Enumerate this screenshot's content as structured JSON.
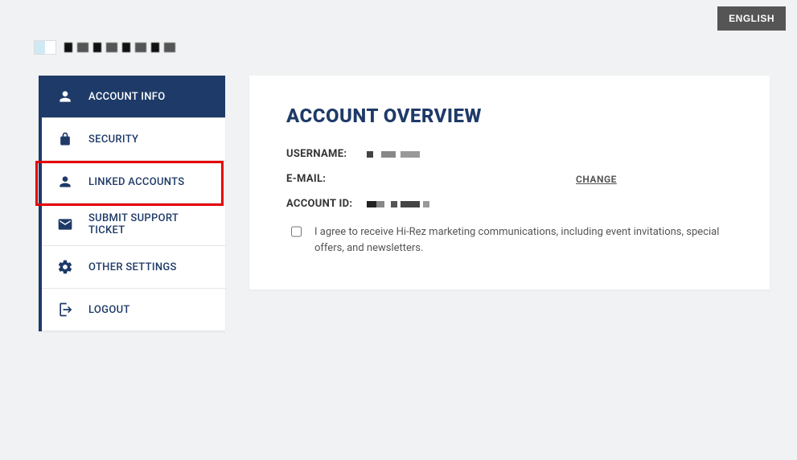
{
  "lang_button": "ENGLISH",
  "sidebar": {
    "items": [
      {
        "label": "ACCOUNT INFO"
      },
      {
        "label": "SECURITY"
      },
      {
        "label": "LINKED ACCOUNTS"
      },
      {
        "label": "SUBMIT SUPPORT TICKET"
      },
      {
        "label": "OTHER SETTINGS"
      },
      {
        "label": "LOGOUT"
      }
    ]
  },
  "main": {
    "title": "ACCOUNT OVERVIEW",
    "username_label": "USERNAME:",
    "email_label": "E-MAIL:",
    "change_label": "CHANGE",
    "account_id_label": "ACCOUNT ID:",
    "consent_text": "I agree to receive Hi-Rez marketing communications, including event invitations, special offers, and newsletters."
  }
}
